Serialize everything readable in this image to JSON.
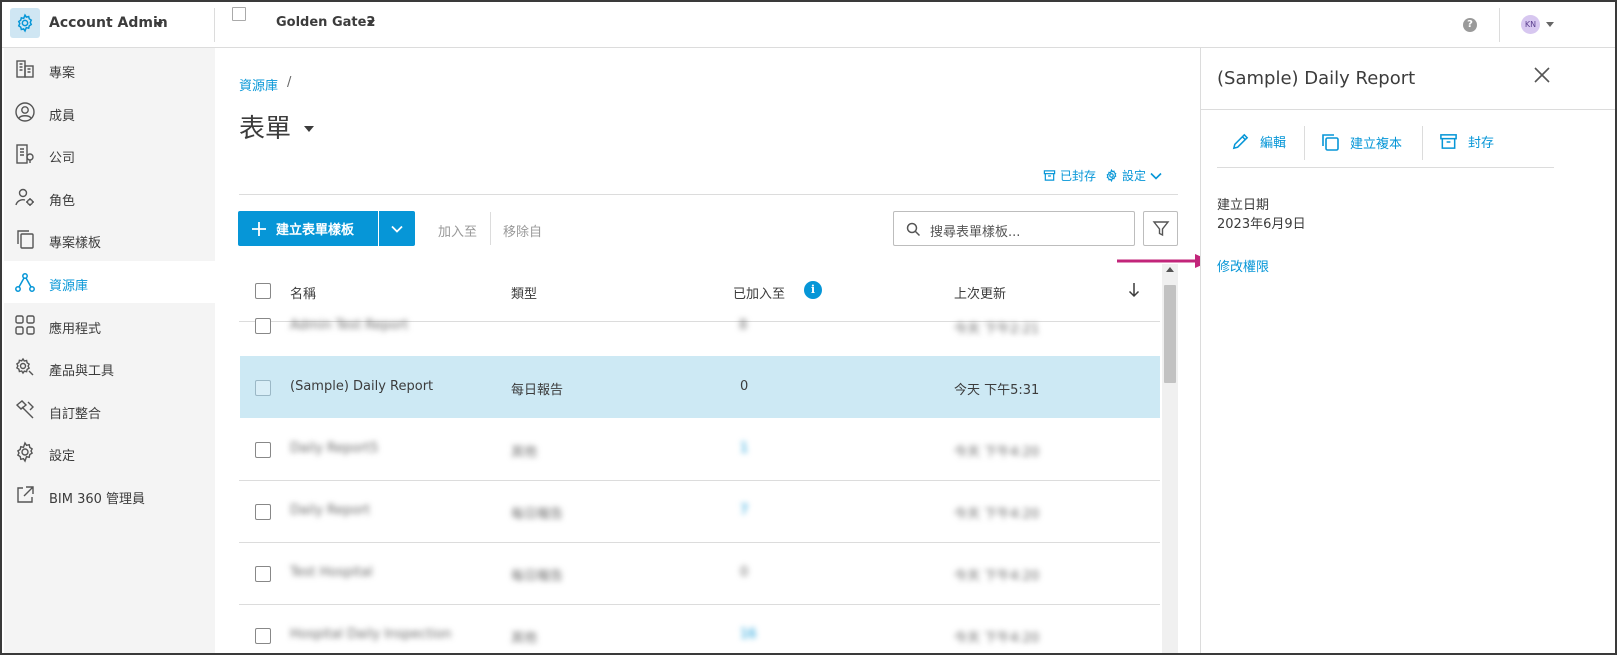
{
  "topbar": {
    "account_name": "Account Admin",
    "project_name": "Golden Gate2",
    "help_label": "?",
    "avatar_initials": "KN"
  },
  "sidebar": {
    "items": [
      {
        "label": "專案",
        "icon": "building-icon"
      },
      {
        "label": "成員",
        "icon": "user-circle-icon"
      },
      {
        "label": "公司",
        "icon": "company-icon"
      },
      {
        "label": "角色",
        "icon": "role-icon"
      },
      {
        "label": "專案樣板",
        "icon": "template-icon"
      },
      {
        "label": "資源庫",
        "icon": "library-icon",
        "active": true
      },
      {
        "label": "應用程式",
        "icon": "apps-grid-icon"
      },
      {
        "label": "產品與工具",
        "icon": "tools-gear-icon"
      },
      {
        "label": "自訂整合",
        "icon": "hammer-icon"
      },
      {
        "label": "設定",
        "icon": "gear-icon"
      },
      {
        "label": "BIM 360 管理員",
        "icon": "external-link-icon"
      }
    ]
  },
  "main": {
    "breadcrumb": "資源庫",
    "breadcrumb_sep": "/",
    "title": "表單",
    "archived_link": "已封存",
    "settings_link": "設定",
    "toolbar": {
      "create_label": "建立表單樣板",
      "add_to": "加入至",
      "remove_from": "移除自",
      "search_placeholder": "搜尋表單樣板..."
    },
    "table": {
      "columns": [
        "名稱",
        "類型",
        "已加入至",
        "上次更新"
      ],
      "info_badge": "i",
      "rows": [
        {
          "name": "Admin Test Report",
          "type": "",
          "added": "8",
          "updated": "今天 下午2:21",
          "blurred": true,
          "partial": true
        },
        {
          "name": "(Sample) Daily Report",
          "type": "每日報告",
          "added": "0",
          "updated": "今天 下午5:31",
          "selected": true
        },
        {
          "name": "Daily Report5",
          "type": "其他",
          "added": "1",
          "updated": "今天 下午4:20",
          "blurred": true
        },
        {
          "name": "Daily Report",
          "type": "每日報告",
          "added": "7",
          "updated": "今天 下午4:20",
          "blurred": true
        },
        {
          "name": "Test Hospital",
          "type": "每日報告",
          "added": "0",
          "updated": "今天 下午4:20",
          "blurred": true
        },
        {
          "name": "Hospital Daily Inspection",
          "type": "其他",
          "added": "16",
          "updated": "今天 下午4:20",
          "blurred": true,
          "partial": true
        }
      ]
    }
  },
  "panel": {
    "title": "(Sample) Daily Report",
    "actions": {
      "edit": "編輯",
      "duplicate": "建立複本",
      "archive": "封存"
    },
    "created_label": "建立日期",
    "created_value": "2023年6月9日",
    "permission_link": "修改權限"
  },
  "colors": {
    "accent": "#0696d7",
    "selected_row": "#cde9f4",
    "annotation_arrow": "#c2257a",
    "sidebar_bg": "#f4f4f4"
  }
}
